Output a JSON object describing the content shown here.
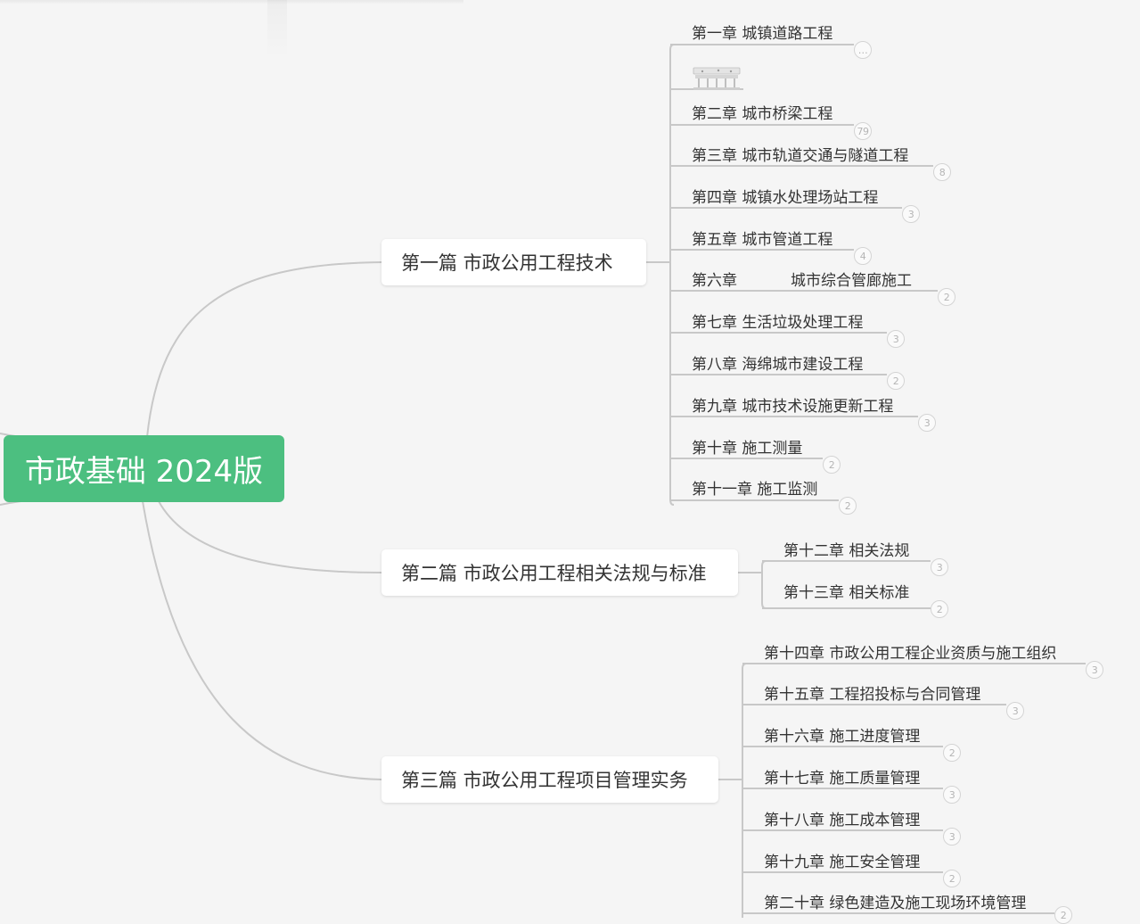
{
  "root": {
    "label": "市政基础 2024版"
  },
  "colors": {
    "root": "#4cbf80",
    "line": "#c8c8c8",
    "badge_border": "#d4d4d4",
    "text": "#333333"
  },
  "sections": [
    {
      "label": "第一篇  市政公用工程技术",
      "chapters": [
        {
          "label": "第一章 城镇道路工程",
          "badge": "…",
          "has_image": true
        },
        {
          "label": "第二章 城市桥梁工程",
          "badge": "79"
        },
        {
          "label": "第三章 城市轨道交通与隧道工程",
          "badge": "8"
        },
        {
          "label": "第四章 城镇水处理场站工程",
          "badge": "3"
        },
        {
          "label": "第五章 城市管道工程",
          "badge": "4"
        },
        {
          "label": "第六章",
          "label_b": "城市综合管廊施工",
          "badge": "2"
        },
        {
          "label": "第七章 生活垃圾处理工程",
          "badge": "3"
        },
        {
          "label": "第八章 海绵城市建设工程",
          "badge": "2"
        },
        {
          "label": "第九章 城市技术设施更新工程",
          "badge": "3"
        },
        {
          "label": "第十章 施工测量",
          "badge": "2"
        },
        {
          "label": "第十一章 施工监测",
          "badge": "2"
        }
      ]
    },
    {
      "label": "第二篇 市政公用工程相关法规与标准",
      "chapters": [
        {
          "label": "第十二章 相关法规",
          "badge": "3"
        },
        {
          "label": "第十三章 相关标准",
          "badge": "2"
        }
      ]
    },
    {
      "label": "第三篇 市政公用工程项目管理实务",
      "chapters": [
        {
          "label": "第十四章 市政公用工程企业资质与施工组织",
          "badge": "3"
        },
        {
          "label": "第十五章 工程招投标与合同管理",
          "badge": "3"
        },
        {
          "label": "第十六章 施工进度管理",
          "badge": "2"
        },
        {
          "label": "第十七章 施工质量管理",
          "badge": "3"
        },
        {
          "label": "第十八章 施工成本管理",
          "badge": "3"
        },
        {
          "label": "第十九章 施工安全管理",
          "badge": "2"
        },
        {
          "label": "第二十章 绿色建造及施工现场环境管理",
          "badge": "2"
        }
      ]
    }
  ]
}
